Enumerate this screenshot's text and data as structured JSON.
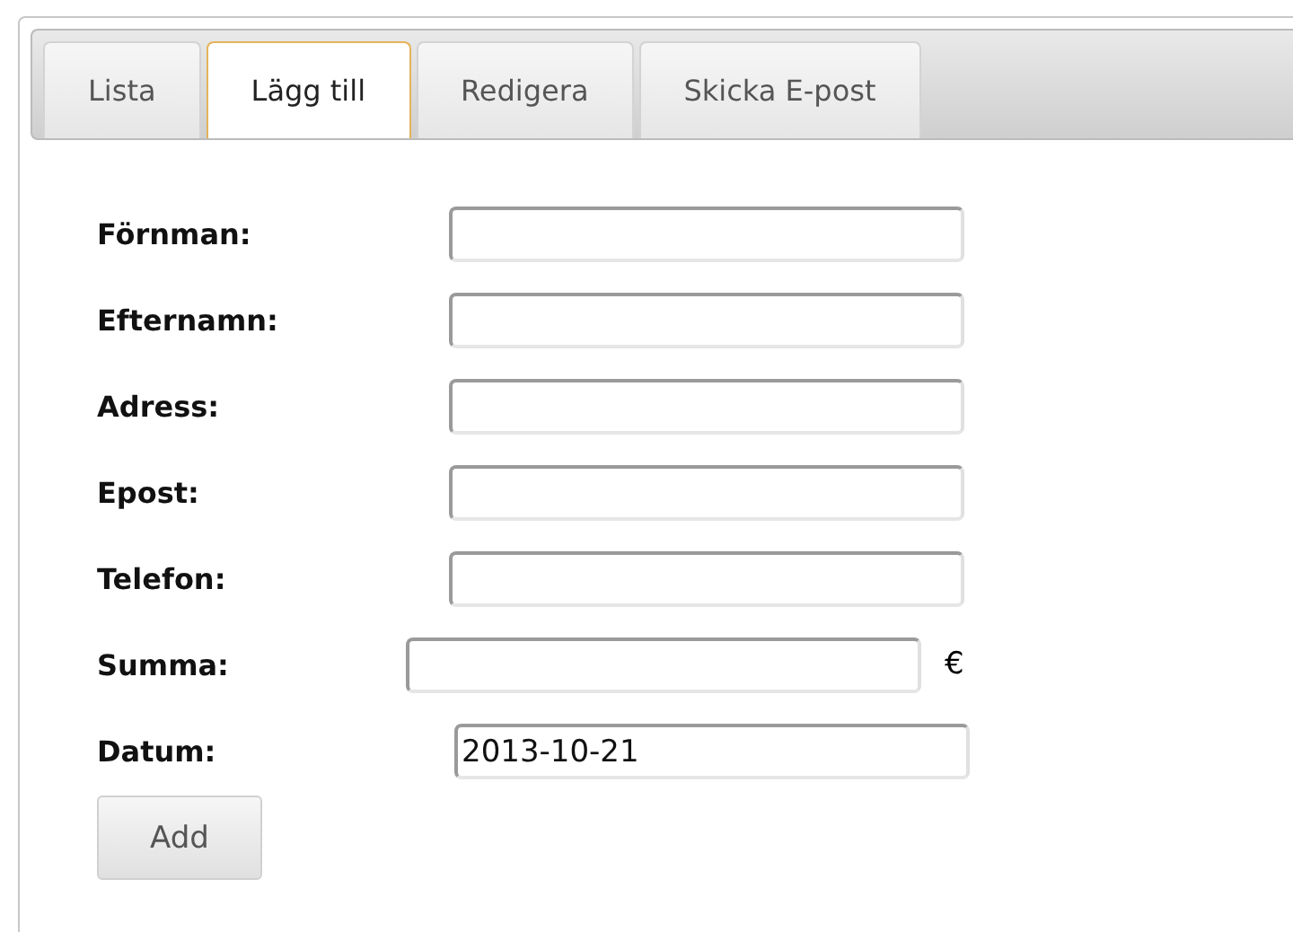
{
  "tabs": [
    {
      "label": "Lista",
      "selected": false
    },
    {
      "label": "Lägg till",
      "selected": true
    },
    {
      "label": "Redigera",
      "selected": false
    },
    {
      "label": "Skicka E-post",
      "selected": false
    }
  ],
  "form": {
    "fields": [
      {
        "label": "Förnman:",
        "kind": "text"
      },
      {
        "label": "Efternamn:",
        "kind": "text"
      },
      {
        "label": "Adress:",
        "kind": "text"
      },
      {
        "label": "Epost:",
        "kind": "text"
      },
      {
        "label": "Telefon:",
        "kind": "text"
      },
      {
        "label": "Summa:",
        "kind": "currency",
        "suffix": "€"
      },
      {
        "label": "Datum:",
        "kind": "date",
        "value": "2013-10-21"
      }
    ],
    "button": "Add"
  }
}
